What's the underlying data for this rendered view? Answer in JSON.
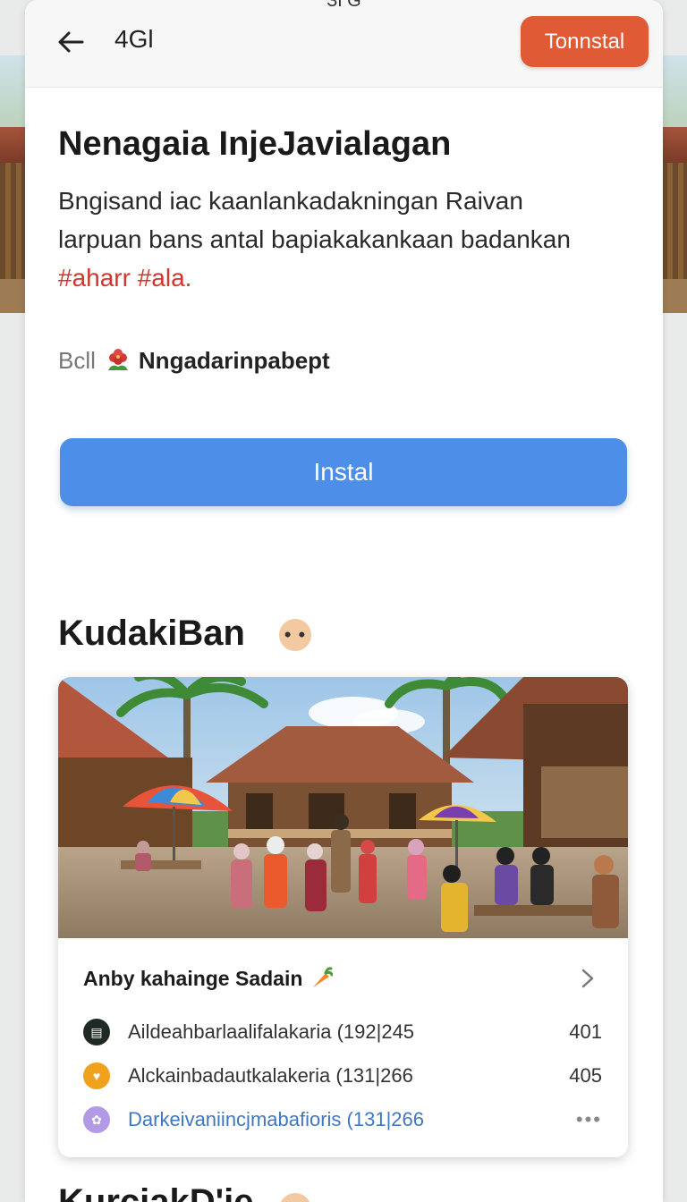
{
  "status_bar": {
    "text": "ЗГG"
  },
  "app_bar": {
    "title": "4Gl",
    "top_install_label": "Tonnstal"
  },
  "app": {
    "name": "Nenagaia InjeJavialagan",
    "description_lines": [
      "Bngisand iac kaanlankadakningan Raivan",
      "larpuan bans antal bapiakakankaan badankan"
    ],
    "tags": "#aharr #ala.",
    "developer_prefix": "Bcll",
    "developer_name": "Nngadarinpabept",
    "developer_icon": "flower-icon"
  },
  "install_button_label": "Instal",
  "section": {
    "title": "KudakiBan",
    "more_icon": "more-dots-icon",
    "more_glyph": "• •"
  },
  "card": {
    "heading": "Anby kahainge Sadain",
    "heading_icon": "carrot-icon",
    "rows": [
      {
        "icon": "dark-badge-icon",
        "color": "#1f2a24",
        "text": "Aildeahbarlaalifalakaria (192|245",
        "value": "401"
      },
      {
        "icon": "heart-face-icon",
        "color": "#f0a21c",
        "text": "Alckainbadautkalakeria (131|266",
        "value": "405"
      },
      {
        "icon": "purple-badge-icon",
        "color": "#b39ae6",
        "text": "Darkeivaniincjmabafioris (131|266",
        "value": "•••"
      }
    ]
  },
  "next_section_peek": "KurciakD'ie"
}
